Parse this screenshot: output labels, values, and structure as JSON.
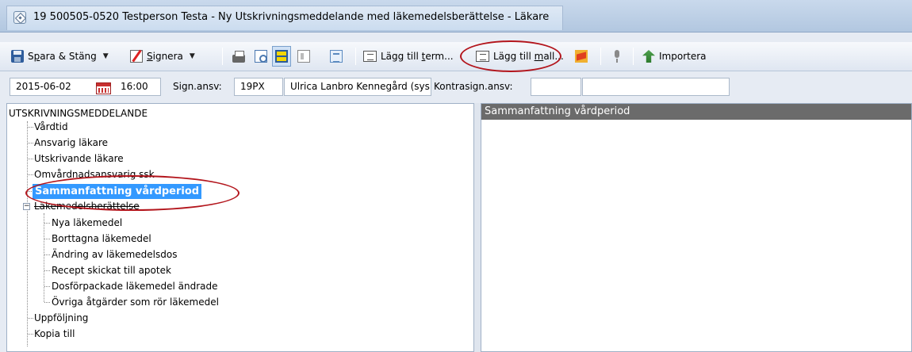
{
  "window": {
    "title": "19 500505-0520 Testperson Testa - Ny Utskrivningsmeddelande med läkemedelsberättelse - Läkare"
  },
  "toolbar": {
    "save_close": {
      "pre": "S",
      "ul": "p",
      "post": "ara & Stäng"
    },
    "sign": {
      "ul": "S",
      "post": "ignera"
    },
    "add_term": {
      "pre": "Lägg till ",
      "ul": "t",
      "post": "erm..."
    },
    "add_template": {
      "pre": "Lägg till ",
      "ul": "m",
      "post": "all..."
    },
    "import": "Importera",
    "dropdown_arrow": "▼"
  },
  "fields": {
    "date": "2015-06-02",
    "time": "16:00",
    "sign_label": "Sign.ansv:",
    "sign_code": "19PX",
    "sign_name": "Ulrica Lanbro Kennegård (sys.",
    "countersign_label": "Kontrasign.ansv:",
    "countersign_code": "",
    "countersign_name": ""
  },
  "tree": {
    "root": "UTSKRIVNINGSMEDDELANDE",
    "items": [
      {
        "label": "Vårdtid"
      },
      {
        "label": "Ansvarig läkare"
      },
      {
        "label": "Utskrivande läkare"
      },
      {
        "label": "Omvårdnadsansvarig ssk"
      },
      {
        "label": "Sammanfattning vårdperiod",
        "selected": true
      },
      {
        "label": "Läkemedelsberättelse",
        "expander": "−"
      },
      {
        "label": "Uppföljning"
      },
      {
        "label": "Kopia till"
      }
    ],
    "children": [
      {
        "label": "Nya läkemedel"
      },
      {
        "label": "Borttagna läkemedel"
      },
      {
        "label": "Ändring av läkemedelsdos"
      },
      {
        "label": "Recept skickat till apotek"
      },
      {
        "label": "Dosförpackade läkemedel ändrade"
      },
      {
        "label": "Övriga åtgärder som rör läkemedel"
      }
    ]
  },
  "content": {
    "section_header": "Sammanfattning vårdperiod"
  },
  "colors": {
    "selection": "#3399ff",
    "annotation": "#b3151c",
    "header_bg": "#6b6b6b"
  },
  "icons": [
    "app-icon",
    "save-icon",
    "sign-icon",
    "print-icon",
    "preview-icon",
    "view-icon",
    "add-term-icon",
    "add-template-icon",
    "flag-icon",
    "microphone-icon",
    "import-icon",
    "calendar-icon"
  ]
}
